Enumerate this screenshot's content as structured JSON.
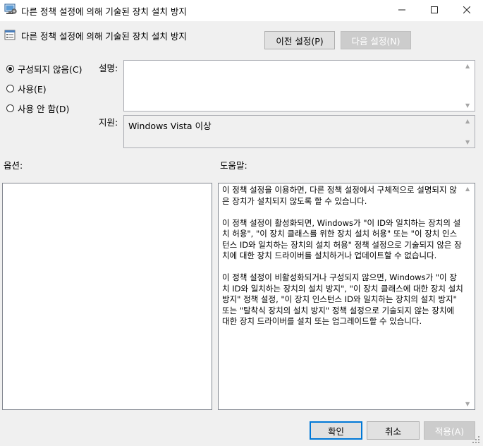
{
  "window": {
    "title": "다른 정책 설정에 의해 기술된 장치 설치 방지",
    "app_icon": "policy-editor-icon",
    "controls": {
      "minimize": "minimize-icon",
      "maximize": "maximize-icon",
      "close": "close-icon"
    }
  },
  "header": {
    "policy_title": "다른 정책 설정에 의해 기술된 장치 설치 방지",
    "policy_icon": "policy-setting-icon",
    "prev_button": "이전 설정(P)",
    "next_button": "다음 설정(N)"
  },
  "state": {
    "options": [
      {
        "label": "구성되지 않음(C)",
        "checked": true
      },
      {
        "label": "사용(E)",
        "checked": false
      },
      {
        "label": "사용 안 함(D)",
        "checked": false
      }
    ]
  },
  "comment": {
    "label": "설명:",
    "value": ""
  },
  "supported": {
    "label": "지원:",
    "value": "Windows Vista 이상"
  },
  "options_panel": {
    "label": "옵션:"
  },
  "help_panel": {
    "label": "도움말:",
    "paragraphs": [
      "이 정책 설정을 이용하면, 다른 정책 설정에서 구체적으로 설명되지 않은 장치가 설치되지 않도록 할 수 있습니다.",
      "이 정책 설정이 활성화되면, Windows가 \"이 ID와 일치하는 장치의 설치 허용\", \"이 장치 클래스를 위한 장치 설치 허용\" 또는 \"이 장치 인스턴스 ID와 일치하는 장치의 설치 허용\" 정책 설정으로 기술되지 않은 장치에 대한 장치 드라이버를 설치하거나 업데이트할 수 없습니다.",
      "이 정책 설정이 비활성화되거나 구성되지 않으면, Windows가 \"이 장치 ID와 일치하는 장치의 설치 방지\", \"이 장치 클래스에 대한 장치 설치 방지\" 정책 설정, \"이 장치 인스턴스 ID와 일치하는 장치의 설치 방지\" 또는 \"탈착식 장치의 설치 방지\" 정책 설정으로 기술되지 않는 장치에 대한 장치 드라이버를 설치 또는 업그레이드할 수 있습니다."
    ]
  },
  "footer": {
    "ok": "확인",
    "cancel": "취소",
    "apply": "적용(A)"
  },
  "colors": {
    "accent": "#0078d7",
    "window_bg": "#f0f0f0",
    "disabled_button": "#cccccc"
  }
}
